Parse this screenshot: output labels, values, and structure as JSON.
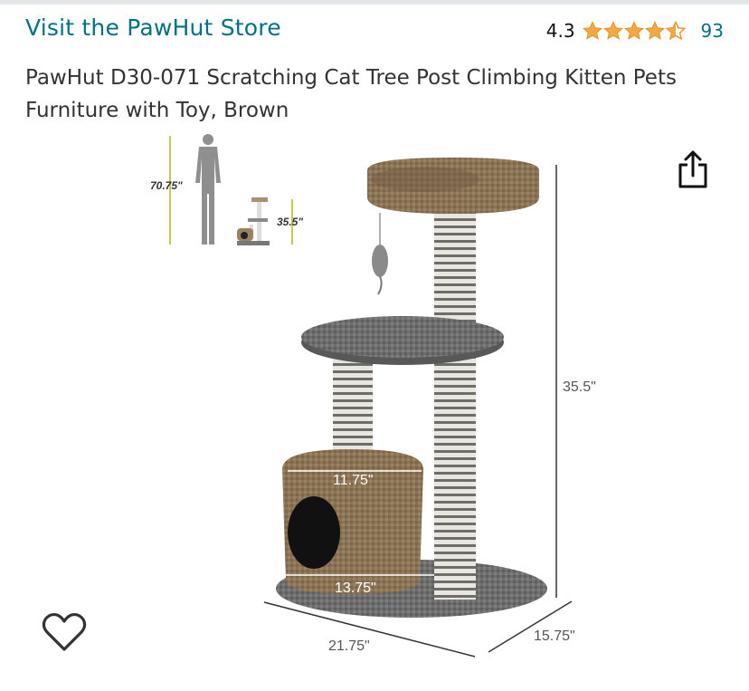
{
  "store": {
    "link_text": "Visit the PawHut Store"
  },
  "rating": {
    "value": "4.3",
    "stars": 4.3,
    "count": "93",
    "star_color": "#f3a847"
  },
  "product": {
    "title": "PawHut D30-071 Scratching Cat Tree Post Climbing Kitten Pets Furniture with Toy, Brown"
  },
  "image": {
    "dimensions": {
      "human_height": "70.75\"",
      "tree_small_height": "35.5\"",
      "height": "35.5\"",
      "condo_top_width": "11.75\"",
      "condo_bottom_width": "13.75\"",
      "base_length": "21.75\"",
      "base_width": "15.75\""
    }
  },
  "icons": {
    "share": "share-icon",
    "wishlist": "heart-outline-icon"
  },
  "colors": {
    "link": "#007185",
    "text": "#0f1111",
    "star": "#f3a847"
  }
}
